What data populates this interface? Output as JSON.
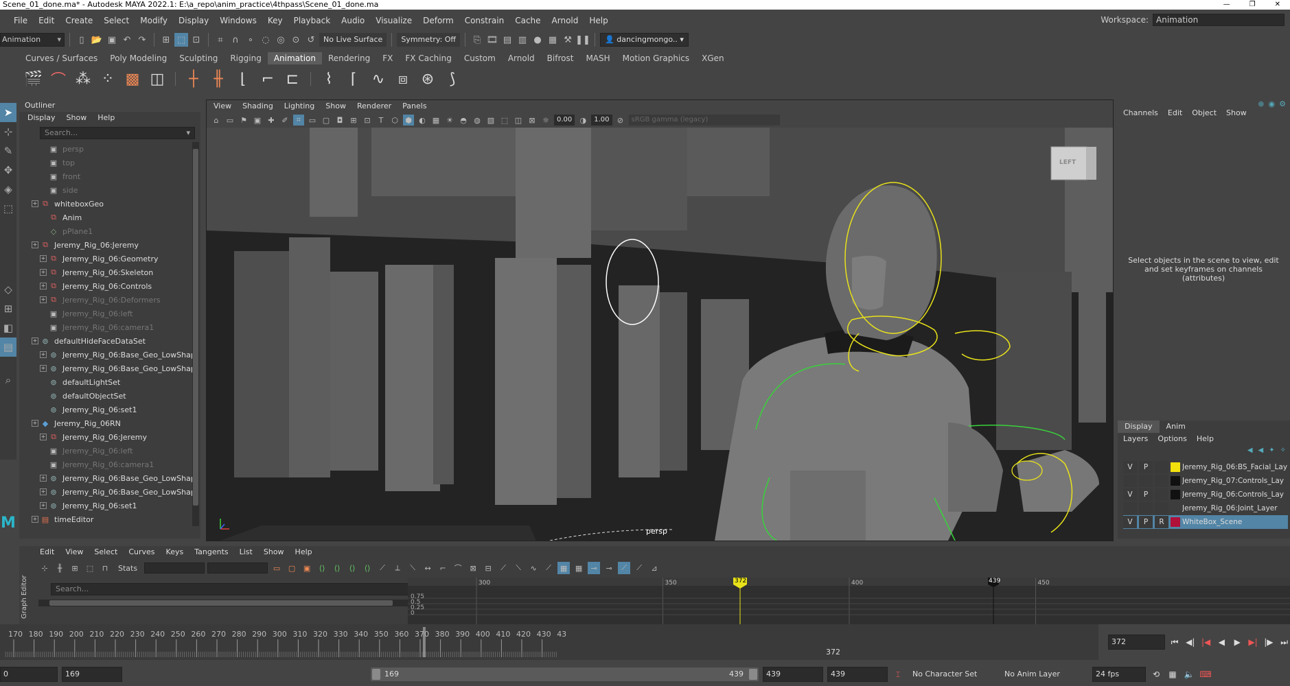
{
  "window": {
    "title": "Scene_01_done.ma* - Autodesk MAYA 2022.1: E:\\a_repo\\anim_practice\\4thpass\\Scene_01_done.ma",
    "controls": [
      "—",
      "❐",
      "✕"
    ]
  },
  "menubar": {
    "items": [
      "File",
      "Edit",
      "Create",
      "Select",
      "Modify",
      "Display",
      "Windows",
      "Key",
      "Playback",
      "Audio",
      "Visualize",
      "Deform",
      "Constrain",
      "Cache",
      "Arnold",
      "Help"
    ],
    "workspace_label": "Workspace:",
    "workspace_value": "Animation"
  },
  "statusline": {
    "mode": "Animation",
    "live_surface": "No Live Surface",
    "symmetry": "Symmetry: Off",
    "user": "dancingmongo.."
  },
  "shelf": {
    "tabs": [
      "Curves / Surfaces",
      "Poly Modeling",
      "Sculpting",
      "Rigging",
      "Animation",
      "Rendering",
      "FX",
      "FX Caching",
      "Custom",
      "Arnold",
      "Bifrost",
      "MASH",
      "Motion Graphics",
      "XGen"
    ],
    "active_tab": "Animation"
  },
  "outliner": {
    "title": "Outliner",
    "menu": [
      "Display",
      "Show",
      "Help"
    ],
    "search_placeholder": "Search...",
    "items": [
      {
        "label": "persp",
        "depth": 1,
        "dim": true,
        "icon": "camera",
        "expand": false
      },
      {
        "label": "top",
        "depth": 1,
        "dim": true,
        "icon": "camera",
        "expand": false
      },
      {
        "label": "front",
        "depth": 1,
        "dim": true,
        "icon": "camera",
        "expand": false
      },
      {
        "label": "side",
        "depth": 1,
        "dim": true,
        "icon": "camera",
        "expand": false
      },
      {
        "label": "whiteboxGeo",
        "depth": 0,
        "dim": false,
        "icon": "transform",
        "expand": true
      },
      {
        "label": "Anim",
        "depth": 1,
        "dim": false,
        "icon": "transform",
        "expand": false
      },
      {
        "label": "pPlane1",
        "depth": 1,
        "dim": true,
        "icon": "mesh",
        "expand": false
      },
      {
        "label": "Jeremy_Rig_06:Jeremy",
        "depth": 0,
        "dim": false,
        "icon": "transform",
        "expand": true
      },
      {
        "label": "Jeremy_Rig_06:Geometry",
        "depth": 1,
        "dim": false,
        "icon": "transform",
        "expand": true
      },
      {
        "label": "Jeremy_Rig_06:Skeleton",
        "depth": 1,
        "dim": false,
        "icon": "transform",
        "expand": true
      },
      {
        "label": "Jeremy_Rig_06:Controls",
        "depth": 1,
        "dim": false,
        "icon": "transform",
        "expand": true
      },
      {
        "label": "Jeremy_Rig_06:Deformers",
        "depth": 1,
        "dim": true,
        "icon": "transform",
        "expand": true
      },
      {
        "label": "Jeremy_Rig_06:left",
        "depth": 1,
        "dim": true,
        "icon": "camera",
        "expand": false
      },
      {
        "label": "Jeremy_Rig_06:camera1",
        "depth": 1,
        "dim": true,
        "icon": "camera",
        "expand": false
      },
      {
        "label": "defaultHideFaceDataSet",
        "depth": 0,
        "dim": false,
        "icon": "set",
        "expand": true
      },
      {
        "label": "Jeremy_Rig_06:Base_Geo_LowShap",
        "depth": 1,
        "dim": false,
        "icon": "set",
        "expand": true
      },
      {
        "label": "Jeremy_Rig_06:Base_Geo_LowShap",
        "depth": 1,
        "dim": false,
        "icon": "set",
        "expand": true
      },
      {
        "label": "defaultLightSet",
        "depth": 1,
        "dim": false,
        "icon": "set",
        "expand": false
      },
      {
        "label": "defaultObjectSet",
        "depth": 1,
        "dim": false,
        "icon": "set",
        "expand": false
      },
      {
        "label": "Jeremy_Rig_06:set1",
        "depth": 1,
        "dim": false,
        "icon": "set",
        "expand": false
      },
      {
        "label": "Jeremy_Rig_06RN",
        "depth": 0,
        "dim": false,
        "icon": "reference",
        "expand": true
      },
      {
        "label": "Jeremy_Rig_06:Jeremy",
        "depth": 1,
        "dim": false,
        "icon": "transform",
        "expand": true
      },
      {
        "label": "Jeremy_Rig_06:left",
        "depth": 1,
        "dim": true,
        "icon": "camera",
        "expand": false
      },
      {
        "label": "Jeremy_Rig_06:camera1",
        "depth": 1,
        "dim": true,
        "icon": "camera",
        "expand": false
      },
      {
        "label": "Jeremy_Rig_06:Base_Geo_LowShap",
        "depth": 1,
        "dim": false,
        "icon": "set",
        "expand": true
      },
      {
        "label": "Jeremy_Rig_06:Base_Geo_LowShap",
        "depth": 1,
        "dim": false,
        "icon": "set",
        "expand": true
      },
      {
        "label": "Jeremy_Rig_06:set1",
        "depth": 1,
        "dim": false,
        "icon": "set",
        "expand": true
      },
      {
        "label": "timeEditor",
        "depth": 0,
        "dim": false,
        "icon": "editor",
        "expand": true
      }
    ]
  },
  "viewport": {
    "menu": [
      "View",
      "Shading",
      "Lighting",
      "Show",
      "Renderer",
      "Panels"
    ],
    "exposure": "0.00",
    "gamma": "1.00",
    "color_space": "sRGB gamma (legacy)",
    "camera_label": "persp",
    "viewcube_label": "LEFT"
  },
  "channelbox": {
    "menu": [
      "Channels",
      "Edit",
      "Object",
      "Show"
    ],
    "message": "Select objects in the scene to view, edit and set keyframes on channels (attributes)",
    "layer_tabs": [
      "Display",
      "Anim"
    ],
    "layer_menu": [
      "Layers",
      "Options",
      "Help"
    ],
    "layers": [
      {
        "v": "V",
        "p": "P",
        "r": "",
        "color": "#f2e10c",
        "name": "Jeremy_Rig_06:BS_Facial_Lay",
        "selected": false
      },
      {
        "v": "",
        "p": "",
        "r": "",
        "color": "#111111",
        "name": "Jeremy_Rig_07:Controls_Lay",
        "selected": false
      },
      {
        "v": "V",
        "p": "P",
        "r": "",
        "color": "#111111",
        "name": "Jeremy_Rig_06:Controls_Lay",
        "selected": false
      },
      {
        "v": "",
        "p": "",
        "r": "",
        "color": "",
        "name": "Jeremy_Rig_06:Joint_Layer",
        "selected": false
      },
      {
        "v": "V",
        "p": "P",
        "r": "R",
        "color": "#b0103a",
        "name": "WhiteBox_Scene",
        "selected": true
      }
    ]
  },
  "graph_editor": {
    "side_label": "Graph Editor",
    "menu": [
      "Edit",
      "View",
      "Select",
      "Curves",
      "Keys",
      "Tangents",
      "List",
      "Show",
      "Help"
    ],
    "stats_label": "Stats",
    "search_placeholder": "Search...",
    "ruler_ticks": [
      "300",
      "350",
      "400",
      "450"
    ],
    "value_ticks": [
      "0.75",
      "0.5",
      "0.25",
      "0"
    ],
    "current_frame_marker": "372",
    "end_marker": "439"
  },
  "timeslider": {
    "ticks": [
      "170",
      "180",
      "190",
      "200",
      "210",
      "220",
      "230",
      "240",
      "250",
      "260",
      "270",
      "280",
      "290",
      "300",
      "310",
      "320",
      "330",
      "340",
      "350",
      "360",
      "370",
      "380",
      "390",
      "400",
      "410",
      "420",
      "430",
      "43"
    ],
    "current_frame": "372",
    "current_frame_field": "372"
  },
  "rangeslider": {
    "start_field": "0",
    "range_start": "169",
    "slider_start": "169",
    "slider_end": "439",
    "range_end": "439",
    "end_field": "439",
    "character_set": "No Character Set",
    "anim_layer": "No Anim Layer",
    "fps": "24 fps"
  }
}
